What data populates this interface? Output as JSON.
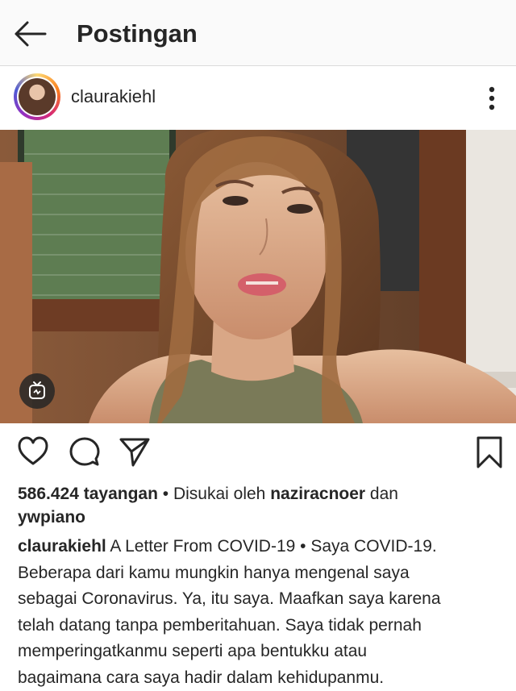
{
  "header": {
    "title": "Postingan"
  },
  "post": {
    "username": "claurakiehl",
    "views": "586.424 tayangan",
    "separator": " • ",
    "liked_by_prefix": "Disukai oleh ",
    "liked_by_user": "naziracnoer",
    "liked_by_and": " dan",
    "liked_by_user2": "ywpiano",
    "caption_user": "claurakiehl",
    "caption_lines": [
      " A Letter From COVID-19 • Saya COVID-19.",
      "Beberapa dari kamu mungkin hanya mengenal saya",
      "sebagai Coronavirus. Ya, itu saya. Maafkan saya karena",
      "telah datang tanpa pemberitahuan. Saya tidak pernah",
      "memperingatkanmu seperti apa bentukku atau",
      "bagaimana cara saya hadir dalam kehidupanmu."
    ]
  },
  "icons": {
    "back": "back-arrow-icon",
    "more": "more-vertical-icon",
    "igtv": "igtv-icon",
    "like": "heart-icon",
    "comment": "comment-icon",
    "share": "share-icon",
    "save": "bookmark-icon"
  },
  "colors": {
    "text": "#262626",
    "border": "#dbdbdb",
    "topbar_bg": "#fafafa"
  }
}
